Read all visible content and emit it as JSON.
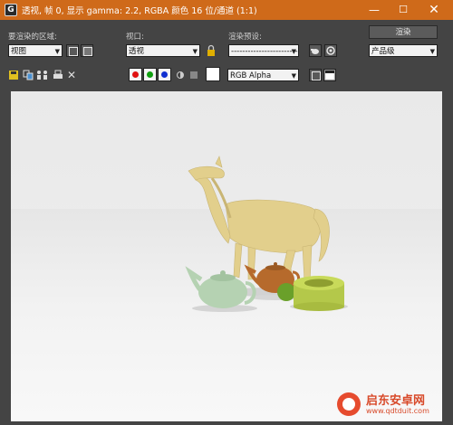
{
  "window": {
    "title": "透视, 帧 0, 显示 gamma: 2.2, RGBA 颜色 16 位/通道 (1:1)",
    "minimize_glyph": "—",
    "maximize_glyph": "☐",
    "close_glyph": "✕"
  },
  "controls": {
    "area_label": "要渲染的区域:",
    "area_value": "视图",
    "viewport_label": "视口:",
    "viewport_value": "透视",
    "preset_label": "渲染预设:",
    "preset_value": "-------------------------",
    "render_button": "渲染",
    "quality_value": "产品级"
  },
  "toolbar": {
    "channel_select": "RGB Alpha",
    "channels": [
      {
        "name": "red",
        "color": "#e01010"
      },
      {
        "name": "green",
        "color": "#10a010"
      },
      {
        "name": "blue",
        "color": "#1030d0"
      }
    ],
    "clear_glyph": "✕"
  },
  "watermark": {
    "brand": "启东安卓网",
    "url": "www.qdtduit.com"
  },
  "colors": {
    "titlebar": "#cf6a1a",
    "panel": "#444444",
    "horse": "#e2cf8c",
    "teapot_green": "#b5d2b2",
    "teapot_brown": "#b66a2c",
    "torus": "#b4c84a"
  }
}
